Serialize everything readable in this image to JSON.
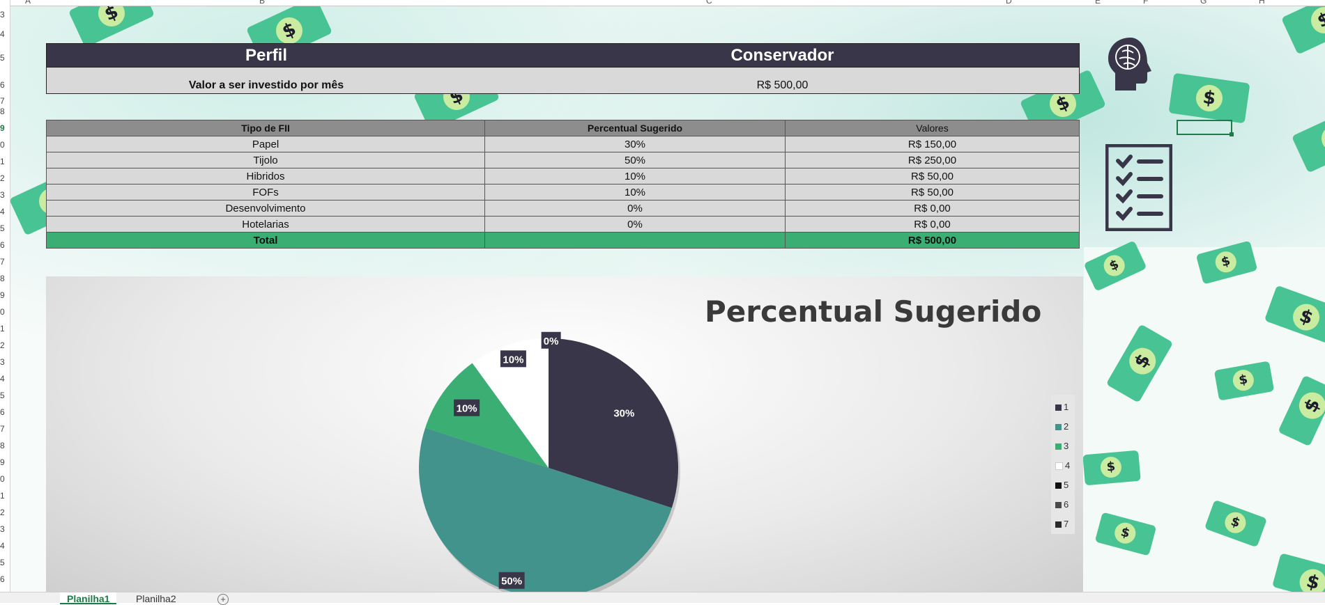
{
  "grid": {
    "row_numbers": [
      "3",
      "4",
      "5",
      "6",
      "7",
      "8",
      "9",
      "0",
      "1",
      "2",
      "3",
      "4",
      "5",
      "6",
      "7",
      "8",
      "9",
      "0",
      "1",
      "2",
      "3",
      "4",
      "5",
      "6",
      "7",
      "8",
      "9",
      "0",
      "1",
      "2",
      "3",
      "4",
      "5",
      "6"
    ],
    "column_letters": [
      "A",
      "B",
      "C",
      "D",
      "E",
      "F",
      "G",
      "H"
    ]
  },
  "profile": {
    "label": "Perfil",
    "value": "Conservador",
    "amount_label": "Valor a ser investido por mês",
    "amount_value": "R$ 500,00"
  },
  "fii_table": {
    "headers": [
      "Tipo de FII",
      "Percentual Sugerido",
      "Valores"
    ],
    "rows": [
      [
        "Papel",
        "30%",
        "R$ 150,00"
      ],
      [
        "Tijolo",
        "50%",
        "R$ 250,00"
      ],
      [
        "Hibridos",
        "10%",
        "R$ 50,00"
      ],
      [
        "FOFs",
        "10%",
        "R$ 50,00"
      ],
      [
        "Desenvolvimento",
        "0%",
        "R$ 0,00"
      ],
      [
        "Hotelarias",
        "0%",
        "R$ 0,00"
      ]
    ],
    "total": [
      "Total",
      "",
      "R$ 500,00"
    ]
  },
  "chart_data": {
    "type": "pie",
    "title": "Percentual Sugerido",
    "categories": [
      "1",
      "2",
      "3",
      "4",
      "5",
      "6",
      "7"
    ],
    "values": [
      30,
      50,
      10,
      10,
      0,
      0,
      0
    ],
    "data_labels": [
      "30%",
      "50%",
      "10%",
      "10%",
      "0%"
    ],
    "colors": [
      "#383648",
      "#42938b",
      "#3aae73",
      "#ffffff",
      "#111111",
      "#4a4a4a",
      "#2a2a2a"
    ],
    "legend_position": "right"
  },
  "tabs": [
    "Planilha1",
    "Planilha2"
  ],
  "icons": [
    "brain-head-icon",
    "checklist-icon",
    "add-sheet-icon",
    "dollar-bill-icon"
  ]
}
